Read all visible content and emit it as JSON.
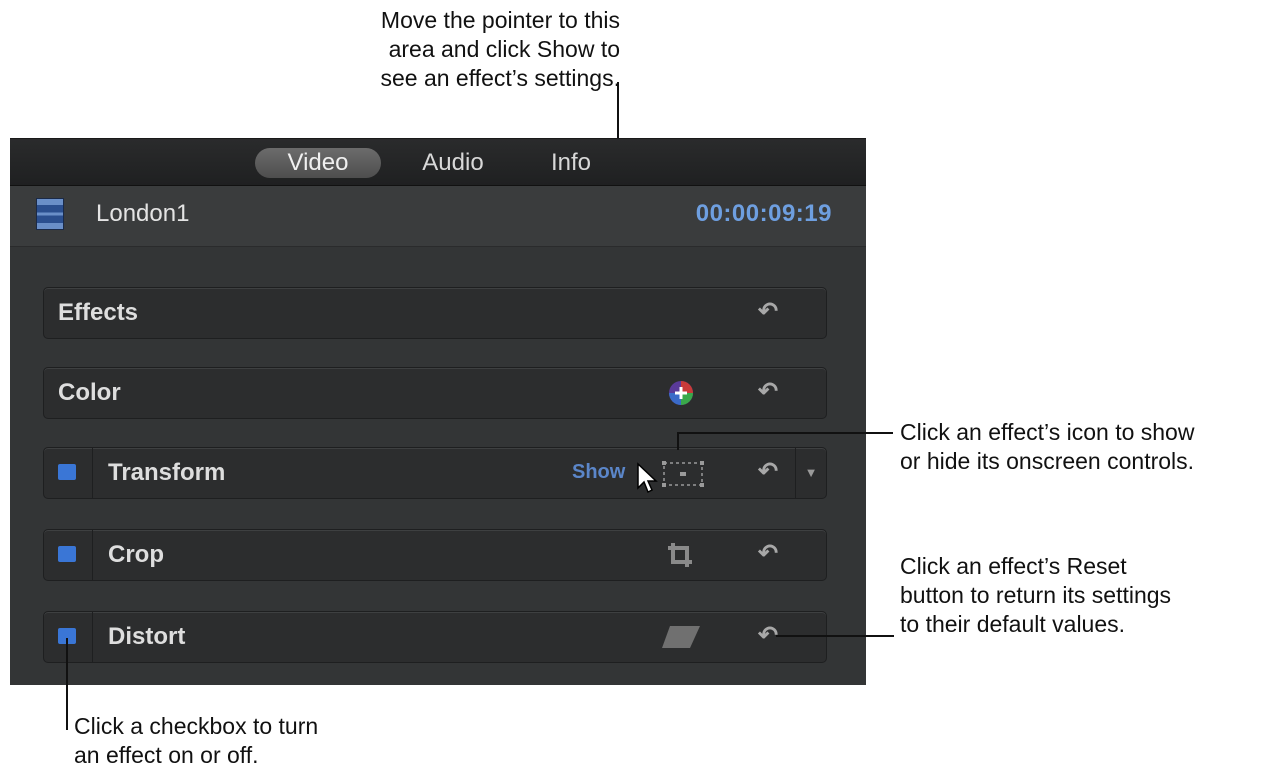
{
  "tabs": [
    {
      "label": "Video"
    },
    {
      "label": "Audio"
    },
    {
      "label": "Info"
    }
  ],
  "clip": {
    "name": "London1",
    "timecode": "00:00:09:19"
  },
  "sections": {
    "effects": {
      "label": "Effects"
    },
    "color": {
      "label": "Color"
    }
  },
  "effects": [
    {
      "label": "Transform",
      "show": "Show",
      "checked": true
    },
    {
      "label": "Crop",
      "checked": true
    },
    {
      "label": "Distort",
      "checked": true
    }
  ],
  "annotations": {
    "show_callout": [
      "Move the pointer to this",
      "area and click Show to",
      "see an effect’s settings."
    ],
    "icon_callout": [
      "Click an effect’s icon to show",
      "or hide its onscreen controls."
    ],
    "reset_callout": [
      "Click an effect’s Reset",
      "button to return its settings",
      "to their default values."
    ],
    "checkbox_callout": [
      "Click a checkbox to turn",
      "an effect on or off."
    ]
  },
  "colors": {
    "accent": "#3a76d6",
    "timecode": "#6e9fe0",
    "panel": "#333536"
  },
  "icons": {
    "reset": "reset-arrow-icon",
    "color_board": "color-board-icon",
    "transform": "transform-onscreen-icon",
    "crop": "crop-icon",
    "distort": "distort-icon"
  }
}
